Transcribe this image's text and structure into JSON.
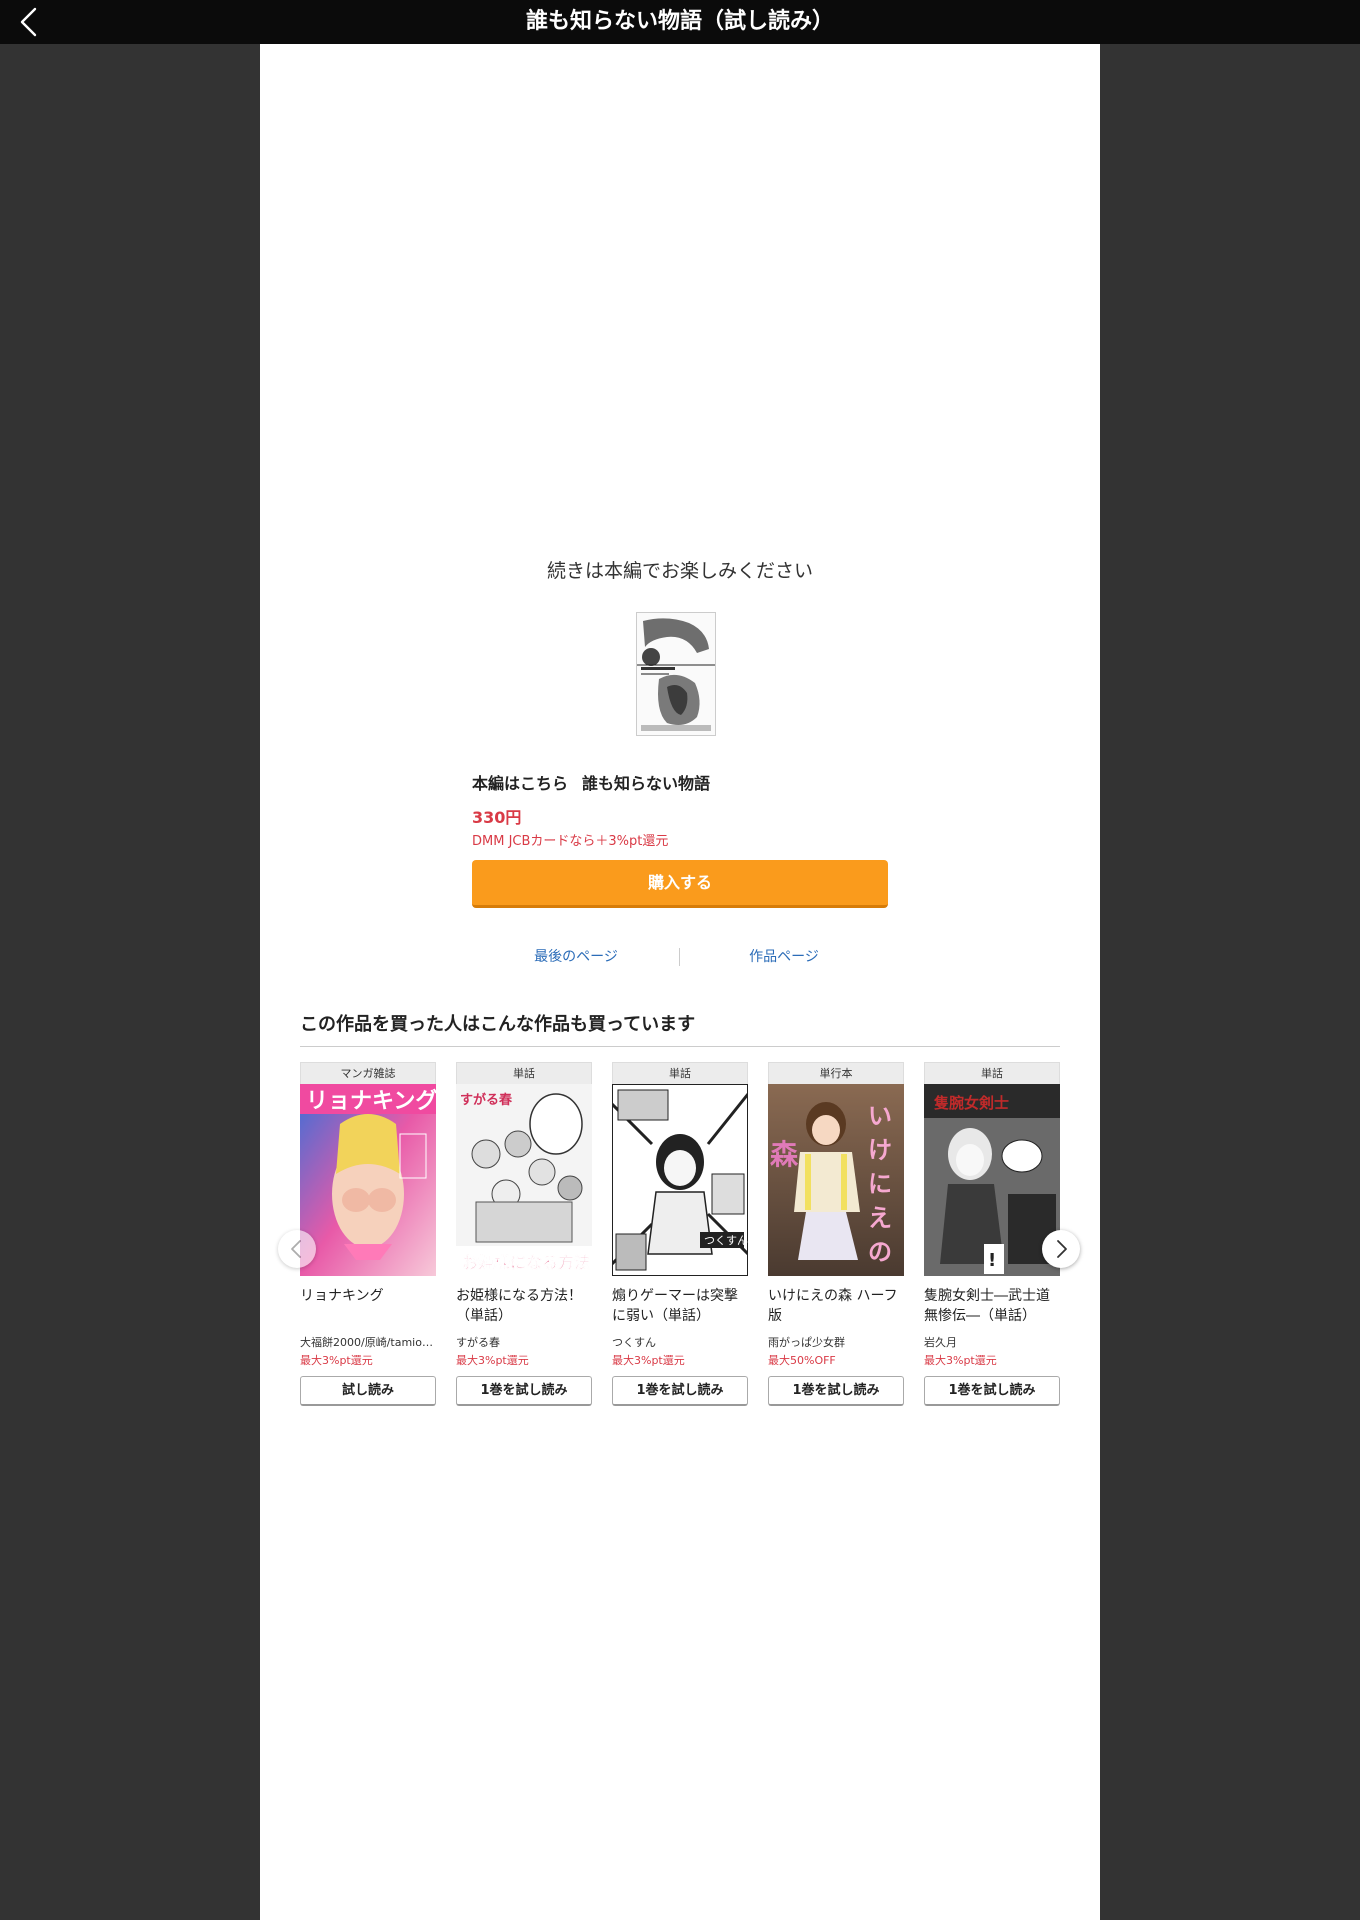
{
  "header": {
    "back_icon": "chevron-left-icon",
    "title": "誰も知らない物語（試し読み）"
  },
  "end_section": {
    "message": "続きは本編でお楽しみください",
    "main_label": "本編はこちら",
    "main_title": "誰も知らない物語",
    "price": "330円",
    "point_note": "DMM JCBカードなら＋3%pt還元",
    "buy_button": "購入する",
    "last_page_link": "最後のページ",
    "work_page_link": "作品ページ"
  },
  "recommend": {
    "heading": "この作品を買った人はこんな作品も買っています",
    "items": [
      {
        "category": "マンガ雑誌",
        "title": "リョナキング",
        "author": "大福餅2000/原崎/tamio/…",
        "promo": "最大3%pt還元",
        "button": "試し読み"
      },
      {
        "category": "単話",
        "title": "お姫様になる方法！（単話）",
        "author": "すがる春",
        "promo": "最大3%pt還元",
        "button": "1巻を試し読み"
      },
      {
        "category": "単話",
        "title": "煽りゲーマーは突撃に弱い（単話）",
        "author": "つくすん",
        "promo": "最大3%pt還元",
        "button": "1巻を試し読み"
      },
      {
        "category": "単行本",
        "title": "いけにえの森 ハーフ版",
        "author": "雨がっぱ少女群",
        "promo": "最大50%OFF",
        "button": "1巻を試し読み"
      },
      {
        "category": "単話",
        "title": "隻腕女剣士―武士道無惨伝―（単話）",
        "author": "岩久月",
        "promo": "最大3%pt還元",
        "button": "1巻を試し読み"
      }
    ],
    "prev_icon": "chevron-left-icon",
    "next_icon": "chevron-right-icon"
  },
  "colors": {
    "accent": "#fa9b1c",
    "price": "#d93a46",
    "link": "#2b6cb8",
    "header_bg": "#0b0b0b",
    "side_bg": "#333333"
  }
}
